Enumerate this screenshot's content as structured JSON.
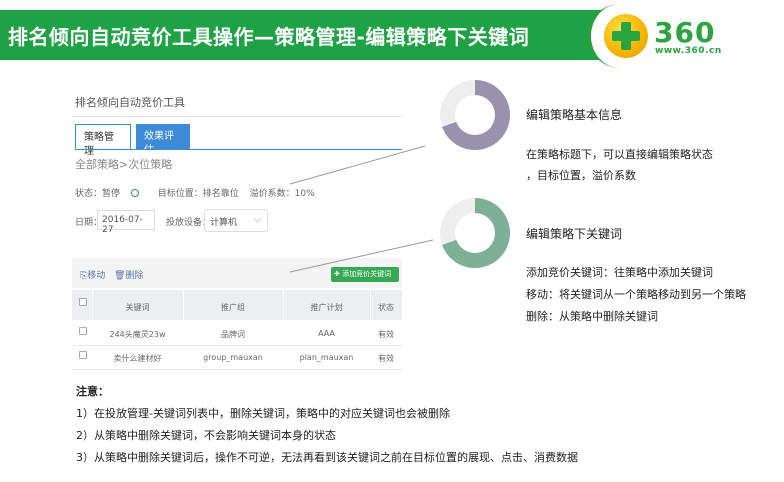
{
  "header": {
    "title": "排名倾向自动竞价工具操作—策略管理-编辑策略下关键词",
    "brand": "360",
    "brand_url": "www.360.cn",
    "accent_color": "#1fa245"
  },
  "app": {
    "title": "排名倾向自动竞价工具",
    "tabs": [
      {
        "label": "策略管理",
        "active": true
      },
      {
        "label": "效果评估",
        "active": false
      }
    ],
    "breadcrumb": "全部策略>次位策略",
    "status": {
      "state": "状态：暂停",
      "target": "目标位置：排名靠位",
      "premium": "溢价系数：10%"
    },
    "date_label": "日期：",
    "date_value": "2016-07-27",
    "device_label": "投放设备：",
    "device_value": "计算机",
    "toolbar": {
      "move_label": "移动",
      "delete_label": "删除",
      "add_label": "添加竞价关键词"
    },
    "table": {
      "headers": [
        "关键词",
        "推广组",
        "推广计划",
        "状态"
      ],
      "rows": [
        [
          "244头魔灵23w",
          "品牌词",
          "AAA",
          "有效"
        ],
        [
          "卖什么建材好",
          "group_mauxan",
          "plan_mauxan",
          "有效"
        ]
      ]
    }
  },
  "callouts": [
    {
      "heading": "编辑策略基本信息",
      "lines": [
        "在策略标题下，可以直接编辑策略状态",
        "，目标位置，溢价系数"
      ],
      "ring_color": "#9892ae",
      "ring_percent": 69
    },
    {
      "heading": "编辑策略下关键词",
      "lines": [
        "添加竞价关键词：往策略中添加关键词",
        "移动：将关键词从一个策略移动到另一个策略",
        "删除：从策略中删除关键词"
      ],
      "ring_color": "#7db096",
      "ring_percent": 69
    }
  ],
  "notes": {
    "heading": "注意：",
    "items": [
      "1）在投放管理-关键词列表中，删除关键词，策略中的对应关键词也会被删除",
      "2）从策略中删除关键词，不会影响关键词本身的状态",
      "3）从策略中删除关键词后，操作不可逆，无法再看到该关键词之前在目标位置的展现、点击、消费数据"
    ]
  }
}
